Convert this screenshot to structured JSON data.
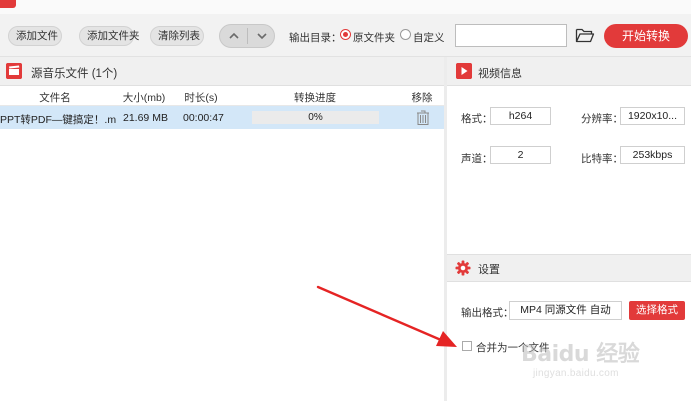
{
  "toolbar": {
    "add_file": "添加文件",
    "add_folder": "添加文件夹",
    "clear_list": "清除列表",
    "output_dir_label": "输出目录：",
    "radio_original": "原文件夹",
    "radio_custom": "自定义",
    "output_path_value": "",
    "start_button": "开始转换"
  },
  "file_list": {
    "title": "源音乐文件 (1个)",
    "columns": [
      "文件名",
      "大小(mb)",
      "时长(s)",
      "转换进度",
      "移除"
    ],
    "rows": [
      {
        "name": "PPT转PDF—键搞定！.m...",
        "size": "21.69 MB",
        "duration": "00:00:47",
        "progress_text": "0%",
        "progress": 0
      }
    ]
  },
  "video_info": {
    "title": "视频信息",
    "format_label": "格式：",
    "format_value": "h264",
    "resolution_label": "分辨率：",
    "resolution_value": "1920x10...",
    "channels_label": "声道：",
    "channels_value": "2",
    "bitrate_label": "比特率：",
    "bitrate_value": "253kbps"
  },
  "settings": {
    "title": "设置",
    "output_format_label": "输出格式：",
    "output_format_value": "MP4 同源文件 自动",
    "select_format_button": "选择格式",
    "merge_label": "合并为一个文件",
    "merge_checked": false
  },
  "watermark": {
    "brand": "Baidu 经验",
    "url": "jingyan.baidu.com"
  },
  "colors": {
    "accent": "#e23a3a",
    "row_selected": "#d3e7f8",
    "panel_header": "#f0f0f0"
  }
}
